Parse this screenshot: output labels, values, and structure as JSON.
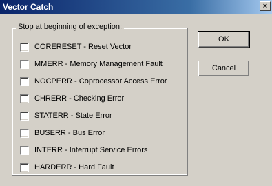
{
  "window": {
    "title": "Vector Catch",
    "close_glyph": "×"
  },
  "group": {
    "label": "Stop at beginning of exception:",
    "items": [
      {
        "label": "CORERESET - Reset Vector",
        "checked": false
      },
      {
        "label": "MMERR - Memory Management Fault",
        "checked": false
      },
      {
        "label": "NOCPERR - Coprocessor Access Error",
        "checked": false
      },
      {
        "label": "CHRERR - Checking Error",
        "checked": false
      },
      {
        "label": "STATERR - State Error",
        "checked": false
      },
      {
        "label": "BUSERR - Bus Error",
        "checked": false
      },
      {
        "label": "INTERR - Interrupt Service Errors",
        "checked": false
      },
      {
        "label": "HARDERR - Hard Fault",
        "checked": false
      }
    ]
  },
  "buttons": {
    "ok_label": "OK",
    "cancel_label": "Cancel"
  }
}
